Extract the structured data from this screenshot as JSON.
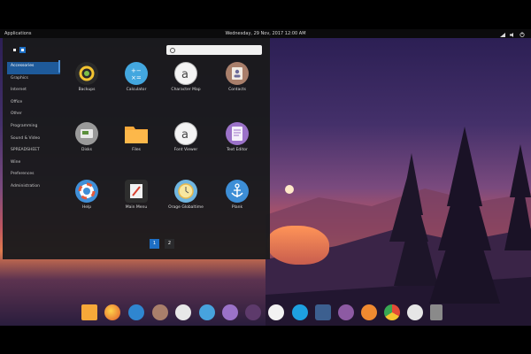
{
  "topbar": {
    "apps_label": "Applications",
    "clock": "Wednesday, 29 Nov, 2017 12:00 AM",
    "tray_icons": [
      "network-icon",
      "volume-icon",
      "power-icon"
    ]
  },
  "launcher": {
    "search_placeholder": "",
    "categories": [
      {
        "label": "Accessories",
        "active": true
      },
      {
        "label": "Graphics"
      },
      {
        "label": "Internet"
      },
      {
        "label": "Office"
      },
      {
        "label": "Other"
      },
      {
        "label": "Programming"
      },
      {
        "label": "Sound & Video"
      },
      {
        "label": "SPREADSHEET"
      },
      {
        "label": "Wine"
      },
      {
        "label": "Preferences"
      },
      {
        "label": "Administration"
      }
    ],
    "apps": [
      {
        "label": "Backups",
        "icon": "backup-icon",
        "color": "#2a2a2a"
      },
      {
        "label": "Calculator",
        "icon": "calculator-icon",
        "color": "#43a7df"
      },
      {
        "label": "Character Map",
        "icon": "character-map-icon",
        "color": "#f4f4f4"
      },
      {
        "label": "Contacts",
        "icon": "contacts-icon",
        "color": "#a97f6b"
      },
      {
        "label": "Disks",
        "icon": "disks-icon",
        "color": "#9a9a9a"
      },
      {
        "label": "Files",
        "icon": "folder-icon",
        "color": "#f7a839"
      },
      {
        "label": "Font Viewer",
        "icon": "font-viewer-icon",
        "color": "#f4f4f4"
      },
      {
        "label": "Text Editor",
        "icon": "text-editor-icon",
        "color": "#9b72c8"
      },
      {
        "label": "Help",
        "icon": "help-icon",
        "color": "#3f8fd8"
      },
      {
        "label": "Main Menu",
        "icon": "main-menu-icon",
        "color": "#2e2e2e"
      },
      {
        "label": "Orage Globaltime",
        "icon": "clock-icon",
        "color": "#6fb5e0"
      },
      {
        "label": "Plank",
        "icon": "anchor-icon",
        "color": "#3d8ed6"
      }
    ],
    "pages": [
      "1",
      "2"
    ]
  },
  "dock": [
    {
      "name": "files-dock-icon",
      "color": "#f7a839"
    },
    {
      "name": "firefox-dock-icon",
      "color": "#e05a2b"
    },
    {
      "name": "browser-dock-icon",
      "color": "#2f86d0"
    },
    {
      "name": "contacts-dock-icon",
      "color": "#a97f6b"
    },
    {
      "name": "calendar-dock-icon",
      "color": "#e8e8e8"
    },
    {
      "name": "mail-dock-icon",
      "color": "#47a3de"
    },
    {
      "name": "document-dock-icon",
      "color": "#9b72c8"
    },
    {
      "name": "dots-dock-icon",
      "color": "#5d3a6b"
    },
    {
      "name": "vlc-dock-icon",
      "color": "#f2f2f2"
    },
    {
      "name": "skype-dock-icon",
      "color": "#1ea0e0"
    },
    {
      "name": "photos-dock-icon",
      "color": "#3c5f8f"
    },
    {
      "name": "app-store-dock-icon",
      "color": "#8d5aa3"
    },
    {
      "name": "music-dock-icon",
      "color": "#f08a30"
    },
    {
      "name": "chrome-dock-icon",
      "color": "#e34b37"
    },
    {
      "name": "settings-dock-icon",
      "color": "#e6e6e6"
    },
    {
      "name": "trash-dock-icon",
      "color": "#8a8a8a"
    }
  ],
  "colors": {
    "accent": "#1e6fc5",
    "panel": "#1a1a1c"
  }
}
